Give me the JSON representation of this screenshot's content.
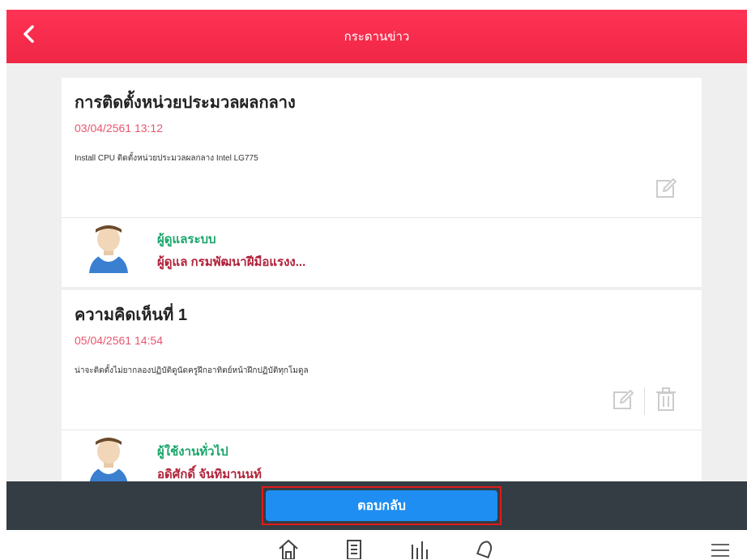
{
  "header": {
    "title": "กระดานข่าว"
  },
  "posts": [
    {
      "title": "การติดตั้งหน่วยประมวลผลกลาง",
      "date": "03/04/2561 13:12",
      "text": "Install CPU ติดตั้งหน่วยประมวลผลกลาง Intel LG775",
      "author_role": "ผู้ดูแลระบบ",
      "author_name": "ผู้ดูแล กรมพัฒนาฝีมือแรงง..."
    },
    {
      "title": "ความคิดเห็นที่ 1",
      "date": "05/04/2561 14:54",
      "text": "น่าจะติดตั้งไม่ยากลองปฏิบัติดูนัดครูฝึกอาทิตย์หน้าฝึกปฏิบัติทุกโมดูล",
      "author_role": "ผู้ใช้งานทั่วไป",
      "author_name": "อดิศักดิ์ จันทิมานนท์"
    }
  ],
  "reply_button": "ตอบกลับ",
  "icons": {
    "back": "chevron-left-icon",
    "edit": "edit-icon",
    "delete": "trash-icon",
    "tabs": [
      "home-icon",
      "news-icon",
      "chart-icon",
      "bell-icon",
      "menu-icon"
    ]
  },
  "colors": {
    "header": "#f02645",
    "date": "#e8566f",
    "role": "#1aa66b",
    "name": "#b0223a",
    "reply": "#1e8ef2",
    "bottom_bar": "#343c44"
  }
}
